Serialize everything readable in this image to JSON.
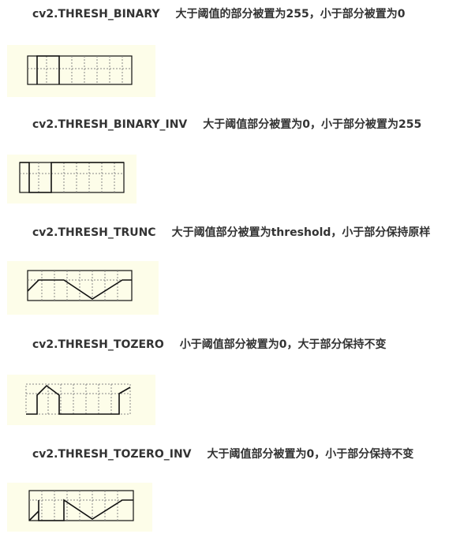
{
  "sections": [
    {
      "constant": "cv2.THRESH_BINARY",
      "description": "大于阈值的部分被置为255，小于部分被置为0",
      "icon": "thresh-binary-diagram"
    },
    {
      "constant": "cv2.THRESH_BINARY_INV",
      "description": "大于阈值部分被置为0，小于部分被置为255",
      "icon": "thresh-binary-inv-diagram"
    },
    {
      "constant": "cv2.THRESH_TRUNC",
      "description": "大于阈值部分被置为threshold，小于部分保持原样",
      "icon": "thresh-trunc-diagram"
    },
    {
      "constant": "cv2.THRESH_TOZERO",
      "description": "小于阈值部分被置为0，大于部分保持不变",
      "icon": "thresh-tozero-diagram"
    },
    {
      "constant": "cv2.THRESH_TOZERO_INV",
      "description": "大于阈值部分被置为0，小于部分保持不变",
      "icon": "thresh-tozero-inv-diagram"
    }
  ],
  "colors": {
    "text": "#333333",
    "figure_background": "#fdfde9",
    "line": "#111111",
    "grid": "#888888"
  }
}
